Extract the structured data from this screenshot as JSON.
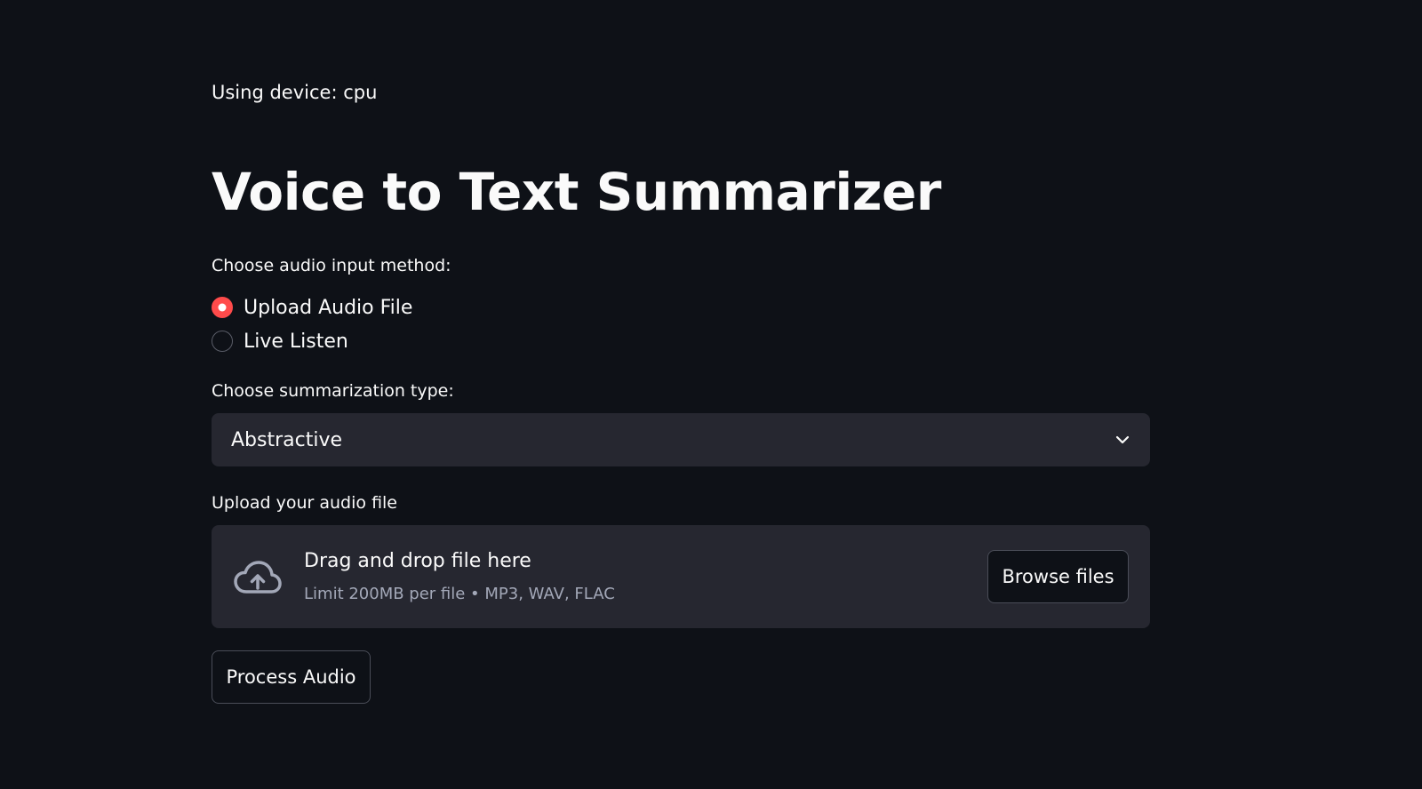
{
  "device": {
    "text": "Using device: cpu"
  },
  "title": "Voice to Text Summarizer",
  "input_method": {
    "label": "Choose audio input method:",
    "options": [
      {
        "label": "Upload Audio File",
        "selected": true
      },
      {
        "label": "Live Listen",
        "selected": false
      }
    ]
  },
  "summarization": {
    "label": "Choose summarization type:",
    "selected_value": "Abstractive"
  },
  "uploader": {
    "label": "Upload your audio file",
    "drop_title": "Drag and drop file here",
    "limit_text": "Limit 200MB per file • MP3, WAV, FLAC",
    "browse_label": "Browse files"
  },
  "process_button_label": "Process Audio",
  "colors": {
    "background": "#0e1117",
    "surface": "#262730",
    "accent": "#ff4b4b",
    "text": "#fafafa",
    "muted_text": "#a3a8b8"
  },
  "icons": {
    "select_chevron": "chevron-down-icon",
    "upload": "cloud-upload-icon"
  }
}
